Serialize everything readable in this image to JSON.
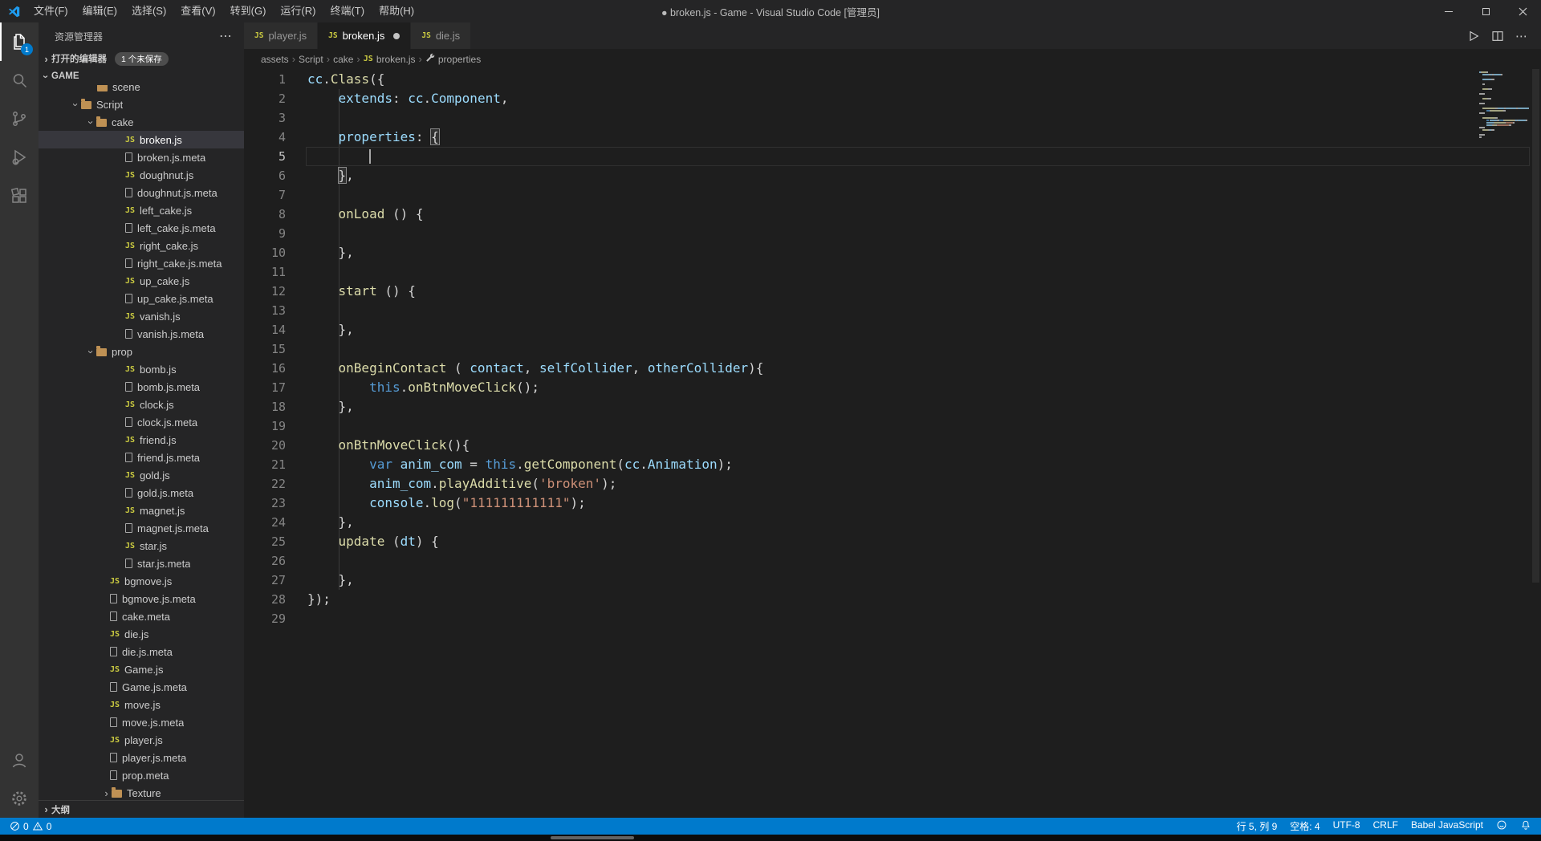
{
  "title_bar": {
    "title": "● broken.js - Game - Visual Studio Code [管理员]",
    "menus": [
      "文件(F)",
      "编辑(E)",
      "选择(S)",
      "查看(V)",
      "转到(G)",
      "运行(R)",
      "终端(T)",
      "帮助(H)"
    ]
  },
  "activity_bar": {
    "explorer_badge": "1"
  },
  "sidebar": {
    "pane_title": "资源管理器",
    "open_editors": {
      "label": "打开的编辑器",
      "badge": "1 个未保存"
    },
    "project_section": "GAME",
    "outline_section": "大纲",
    "tree": [
      {
        "label": "scene",
        "icon": "folder-icon",
        "indent": 73,
        "chevron": "",
        "clipped": true
      },
      {
        "label": "Script",
        "icon": "folder-icon",
        "indent": 40,
        "chevron": "expanded"
      },
      {
        "label": "cake",
        "icon": "folder-icon",
        "indent": 59,
        "chevron": "expanded"
      },
      {
        "label": "broken.js",
        "icon": "js-icon",
        "indent": 108,
        "selected": true
      },
      {
        "label": "broken.js.meta",
        "icon": "file-icon",
        "indent": 108
      },
      {
        "label": "doughnut.js",
        "icon": "js-icon",
        "indent": 108
      },
      {
        "label": "doughnut.js.meta",
        "icon": "file-icon",
        "indent": 108
      },
      {
        "label": "left_cake.js",
        "icon": "js-icon",
        "indent": 108
      },
      {
        "label": "left_cake.js.meta",
        "icon": "file-icon",
        "indent": 108
      },
      {
        "label": "right_cake.js",
        "icon": "js-icon",
        "indent": 108
      },
      {
        "label": "right_cake.js.meta",
        "icon": "file-icon",
        "indent": 108
      },
      {
        "label": "up_cake.js",
        "icon": "js-icon",
        "indent": 108
      },
      {
        "label": "up_cake.js.meta",
        "icon": "file-icon",
        "indent": 108
      },
      {
        "label": "vanish.js",
        "icon": "js-icon",
        "indent": 108
      },
      {
        "label": "vanish.js.meta",
        "icon": "file-icon",
        "indent": 108
      },
      {
        "label": "prop",
        "icon": "folder-icon",
        "indent": 59,
        "chevron": "expanded"
      },
      {
        "label": "bomb.js",
        "icon": "js-icon",
        "indent": 108
      },
      {
        "label": "bomb.js.meta",
        "icon": "file-icon",
        "indent": 108
      },
      {
        "label": "clock.js",
        "icon": "js-icon",
        "indent": 108
      },
      {
        "label": "clock.js.meta",
        "icon": "file-icon",
        "indent": 108
      },
      {
        "label": "friend.js",
        "icon": "js-icon",
        "indent": 108
      },
      {
        "label": "friend.js.meta",
        "icon": "file-icon",
        "indent": 108
      },
      {
        "label": "gold.js",
        "icon": "js-icon",
        "indent": 108
      },
      {
        "label": "gold.js.meta",
        "icon": "file-icon",
        "indent": 108
      },
      {
        "label": "magnet.js",
        "icon": "js-icon",
        "indent": 108
      },
      {
        "label": "magnet.js.meta",
        "icon": "file-icon",
        "indent": 108
      },
      {
        "label": "star.js",
        "icon": "js-icon",
        "indent": 108
      },
      {
        "label": "star.js.meta",
        "icon": "file-icon",
        "indent": 108
      },
      {
        "label": "bgmove.js",
        "icon": "js-icon",
        "indent": 89
      },
      {
        "label": "bgmove.js.meta",
        "icon": "file-icon",
        "indent": 89
      },
      {
        "label": "cake.meta",
        "icon": "file-icon",
        "indent": 89
      },
      {
        "label": "die.js",
        "icon": "js-icon",
        "indent": 89
      },
      {
        "label": "die.js.meta",
        "icon": "file-icon",
        "indent": 89
      },
      {
        "label": "Game.js",
        "icon": "js-icon",
        "indent": 89
      },
      {
        "label": "Game.js.meta",
        "icon": "file-icon",
        "indent": 89
      },
      {
        "label": "move.js",
        "icon": "js-icon",
        "indent": 89
      },
      {
        "label": "move.js.meta",
        "icon": "file-icon",
        "indent": 89
      },
      {
        "label": "player.js",
        "icon": "js-icon",
        "indent": 89
      },
      {
        "label": "player.js.meta",
        "icon": "file-icon",
        "indent": 89
      },
      {
        "label": "prop.meta",
        "icon": "file-icon",
        "indent": 89
      },
      {
        "label": "Texture",
        "icon": "folder-icon",
        "indent": 78,
        "chevron": "collapsed"
      }
    ]
  },
  "tabs": [
    {
      "label": "player.js",
      "active": false,
      "dirty": false
    },
    {
      "label": "broken.js",
      "active": true,
      "dirty": true
    },
    {
      "label": "die.js",
      "active": false,
      "dirty": false
    }
  ],
  "breadcrumbs": [
    {
      "label": "assets"
    },
    {
      "label": "Script"
    },
    {
      "label": "cake"
    },
    {
      "label": "broken.js",
      "icon": "js-icon"
    },
    {
      "label": "properties",
      "icon": "symbol-property-icon"
    }
  ],
  "editor": {
    "cursor": {
      "line": 5,
      "col": 9
    },
    "lines": [
      {
        "tokens": [
          [
            "v",
            "cc"
          ],
          [
            "p",
            "."
          ],
          [
            "fn",
            "Class"
          ],
          [
            "p",
            "({"
          ]
        ]
      },
      {
        "tokens": [
          [
            "p",
            "    "
          ],
          [
            "v",
            "extends"
          ],
          [
            "p",
            ": "
          ],
          [
            "v",
            "cc"
          ],
          [
            "p",
            "."
          ],
          [
            "v",
            "Component"
          ],
          [
            "p",
            ","
          ]
        ]
      },
      {
        "tokens": []
      },
      {
        "tokens": [
          [
            "p",
            "    "
          ],
          [
            "v",
            "properties"
          ],
          [
            "p",
            ": "
          ],
          [
            "bm",
            "{"
          ]
        ]
      },
      {
        "tokens": [
          [
            "p",
            "        "
          ]
        ]
      },
      {
        "tokens": [
          [
            "p",
            "    "
          ],
          [
            "bm",
            "}"
          ],
          [
            "p",
            ","
          ]
        ]
      },
      {
        "tokens": []
      },
      {
        "tokens": [
          [
            "p",
            "    "
          ],
          [
            "fn",
            "onLoad"
          ],
          [
            "p",
            " () {"
          ]
        ]
      },
      {
        "tokens": []
      },
      {
        "tokens": [
          [
            "p",
            "    },"
          ]
        ]
      },
      {
        "tokens": []
      },
      {
        "tokens": [
          [
            "p",
            "    "
          ],
          [
            "fn",
            "start"
          ],
          [
            "p",
            " () {"
          ]
        ]
      },
      {
        "tokens": []
      },
      {
        "tokens": [
          [
            "p",
            "    },"
          ]
        ]
      },
      {
        "tokens": []
      },
      {
        "tokens": [
          [
            "p",
            "    "
          ],
          [
            "fn",
            "onBeginContact"
          ],
          [
            "p",
            " ( "
          ],
          [
            "v",
            "contact"
          ],
          [
            "p",
            ", "
          ],
          [
            "v",
            "selfCollider"
          ],
          [
            "p",
            ", "
          ],
          [
            "v",
            "otherCollider"
          ],
          [
            "p",
            "){"
          ]
        ]
      },
      {
        "tokens": [
          [
            "p",
            "        "
          ],
          [
            "kw",
            "this"
          ],
          [
            "p",
            "."
          ],
          [
            "fn",
            "onBtnMoveClick"
          ],
          [
            "p",
            "();"
          ]
        ]
      },
      {
        "tokens": [
          [
            "p",
            "    },"
          ]
        ]
      },
      {
        "tokens": []
      },
      {
        "tokens": [
          [
            "p",
            "    "
          ],
          [
            "fn",
            "onBtnMoveClick"
          ],
          [
            "p",
            "(){"
          ]
        ]
      },
      {
        "tokens": [
          [
            "p",
            "        "
          ],
          [
            "kw",
            "var"
          ],
          [
            "p",
            " "
          ],
          [
            "v",
            "anim_com"
          ],
          [
            "p",
            " = "
          ],
          [
            "kw",
            "this"
          ],
          [
            "p",
            "."
          ],
          [
            "fn",
            "getComponent"
          ],
          [
            "p",
            "("
          ],
          [
            "v",
            "cc"
          ],
          [
            "p",
            "."
          ],
          [
            "v",
            "Animation"
          ],
          [
            "p",
            ");"
          ]
        ]
      },
      {
        "tokens": [
          [
            "p",
            "        "
          ],
          [
            "v",
            "anim_com"
          ],
          [
            "p",
            "."
          ],
          [
            "fn",
            "playAdditive"
          ],
          [
            "p",
            "("
          ],
          [
            "s",
            "'broken'"
          ],
          [
            "p",
            ");"
          ]
        ]
      },
      {
        "tokens": [
          [
            "p",
            "        "
          ],
          [
            "v",
            "console"
          ],
          [
            "p",
            "."
          ],
          [
            "fn",
            "log"
          ],
          [
            "p",
            "("
          ],
          [
            "s",
            "\"111111111111\""
          ],
          [
            "p",
            ");"
          ]
        ]
      },
      {
        "tokens": [
          [
            "p",
            "    },"
          ]
        ]
      },
      {
        "tokens": [
          [
            "p",
            "    "
          ],
          [
            "fn",
            "update"
          ],
          [
            "p",
            " ("
          ],
          [
            "v",
            "dt"
          ],
          [
            "p",
            ") {"
          ]
        ]
      },
      {
        "tokens": []
      },
      {
        "tokens": [
          [
            "p",
            "    },"
          ]
        ]
      },
      {
        "tokens": [
          [
            "p",
            "});"
          ]
        ]
      },
      {
        "tokens": []
      }
    ]
  },
  "status_bar": {
    "errors": "0",
    "warnings": "0",
    "cursor_position": "行 5, 列 9",
    "indentation": "空格: 4",
    "encoding": "UTF-8",
    "eol": "CRLF",
    "language": "Babel JavaScript"
  },
  "colors": {
    "accent": "#007acc",
    "editor_bg": "#1e1e1e",
    "sidebar_bg": "#252526",
    "activitybar_bg": "#333333"
  }
}
